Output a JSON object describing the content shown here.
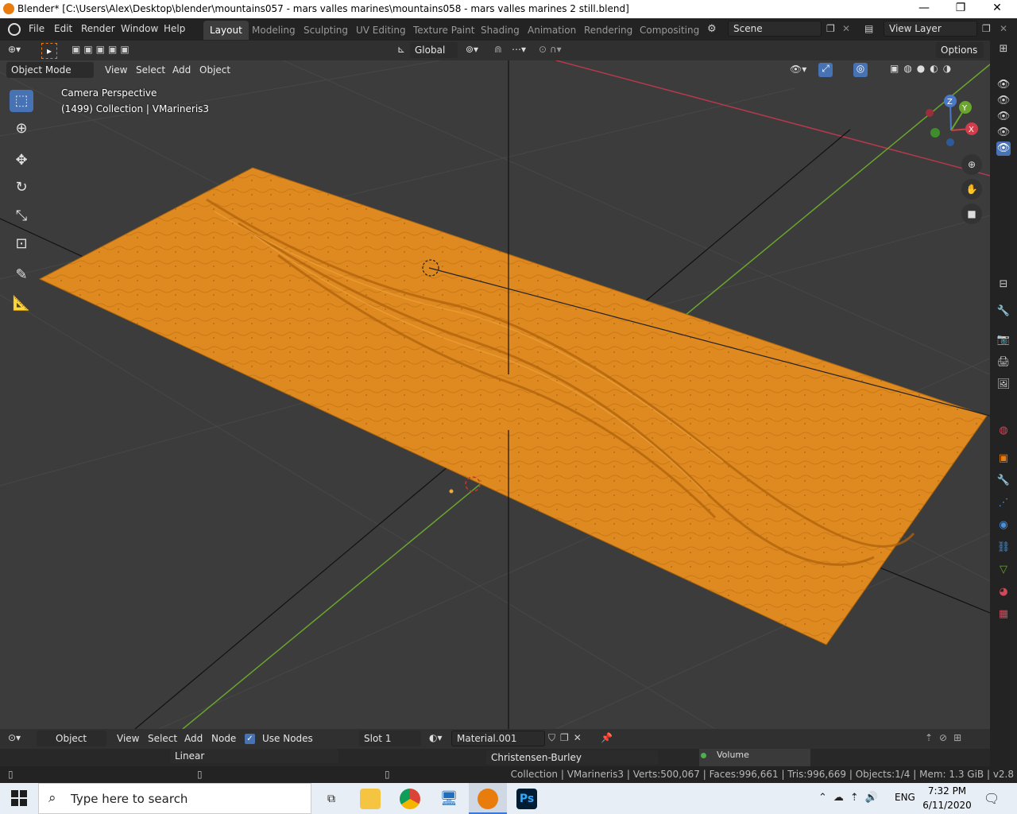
{
  "window": {
    "title": "Blender* [C:\\Users\\Alex\\Desktop\\blender\\mountains057 - mars valles marines\\mountains058 - mars valles marines 2 still.blend]",
    "controls": [
      "—",
      "❐",
      "✕"
    ]
  },
  "menu": [
    "File",
    "Edit",
    "Render",
    "Window",
    "Help"
  ],
  "workspaces": [
    "Layout",
    "Modeling",
    "Sculpting",
    "UV Editing",
    "Texture Paint",
    "Shading",
    "Animation",
    "Rendering",
    "Compositing"
  ],
  "active_workspace": "Layout",
  "scene": {
    "label": "Scene",
    "view_layer": "View Layer"
  },
  "header": {
    "transform_orientation": "Global",
    "options": "Options",
    "mode": "Object Mode",
    "view_menu": [
      "View",
      "Select",
      "Add",
      "Object"
    ]
  },
  "viewport": {
    "camera_label": "Camera Perspective",
    "collection_label": "(1499) Collection | VMarineris3",
    "gizmo_axes": [
      "X",
      "Y",
      "Z"
    ],
    "terrain_color": "#e08a1e",
    "grid_color": "#474747",
    "x_axis_color": "#b5394e",
    "y_axis_color": "#6aa52e"
  },
  "node_editor": {
    "editor_type": "Object",
    "menu": [
      "View",
      "Select",
      "Add",
      "Node"
    ],
    "use_nodes_label": "Use Nodes",
    "use_nodes_checked": true,
    "slot": "Slot 1",
    "material": "Material.001",
    "interpolation": "Linear",
    "subsurface_method": "Christensen-Burley",
    "volume_label": "Volume"
  },
  "status": {
    "text": "Collection | VMarineris3 | Verts:500,067 | Faces:996,661 | Tris:996,669 | Objects:1/4 | Mem: 1.3 GiB | v2.8"
  },
  "taskbar": {
    "search_placeholder": "Type here to search",
    "language": "ENG",
    "time": "7:32 PM",
    "date": "6/11/2020",
    "apps": [
      "task-view-icon",
      "file-explorer-icon",
      "chrome-icon",
      "remote-desktop-icon",
      "blender-icon",
      "photoshop-icon"
    ]
  }
}
